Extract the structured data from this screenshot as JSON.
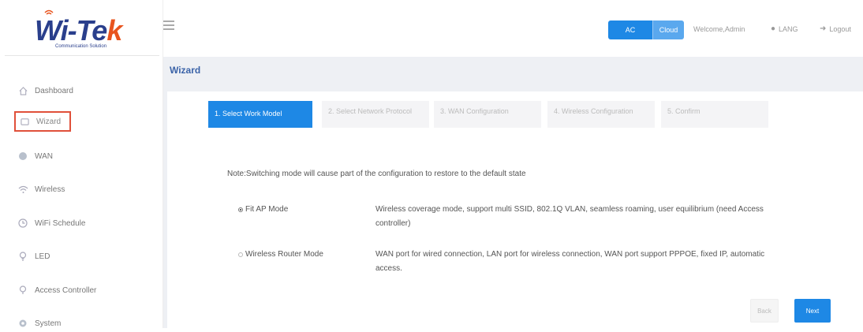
{
  "brand": {
    "logo_main": "Wi-Te",
    "logo_accent": "k",
    "tagline": "Communication Solution"
  },
  "sidebar": {
    "items": [
      {
        "label": "Dashboard",
        "icon": "home-icon"
      },
      {
        "label": "Wizard",
        "icon": "wizard-icon",
        "active": true
      },
      {
        "label": "WAN",
        "icon": "globe-icon"
      },
      {
        "label": "Wireless",
        "icon": "wifi-icon"
      },
      {
        "label": "WiFi Schedule",
        "icon": "clock-icon"
      },
      {
        "label": "LED",
        "icon": "bulb-icon"
      },
      {
        "label": "Access Controller",
        "icon": "controller-icon"
      },
      {
        "label": "System",
        "icon": "gear-icon"
      }
    ]
  },
  "header": {
    "mode_ac": "AC",
    "mode_cloud": "Cloud",
    "welcome": "Welcome,Admin",
    "lang": "LANG",
    "logout": "Logout"
  },
  "page": {
    "title": "Wizard"
  },
  "wizard": {
    "steps": [
      {
        "label": "1. Select Work Model",
        "active": true
      },
      {
        "label": "2. Select Network Protocol"
      },
      {
        "label": "3. WAN Configuration"
      },
      {
        "label": "4. Wireless Configuration"
      },
      {
        "label": "5. Confirm"
      }
    ],
    "note": "Note:Switching mode will cause part of the configuration to restore to the default state",
    "modes": [
      {
        "label": "Fit AP Mode",
        "checked": true,
        "description": "Wireless coverage mode, support multi SSID, 802.1Q VLAN, seamless roaming, user equilibrium (need Access controller)"
      },
      {
        "label": "Wireless Router Mode",
        "checked": false,
        "description": "WAN port for wired connection, LAN port for wireless connection, WAN port support PPPOE, fixed IP, automatic access."
      }
    ],
    "back_label": "Back",
    "next_label": "Next"
  },
  "colors": {
    "accent": "#1e88e5",
    "active_outline": "#e0503a",
    "brand_blue": "#2a3f8c",
    "brand_orange": "#e8541e"
  }
}
